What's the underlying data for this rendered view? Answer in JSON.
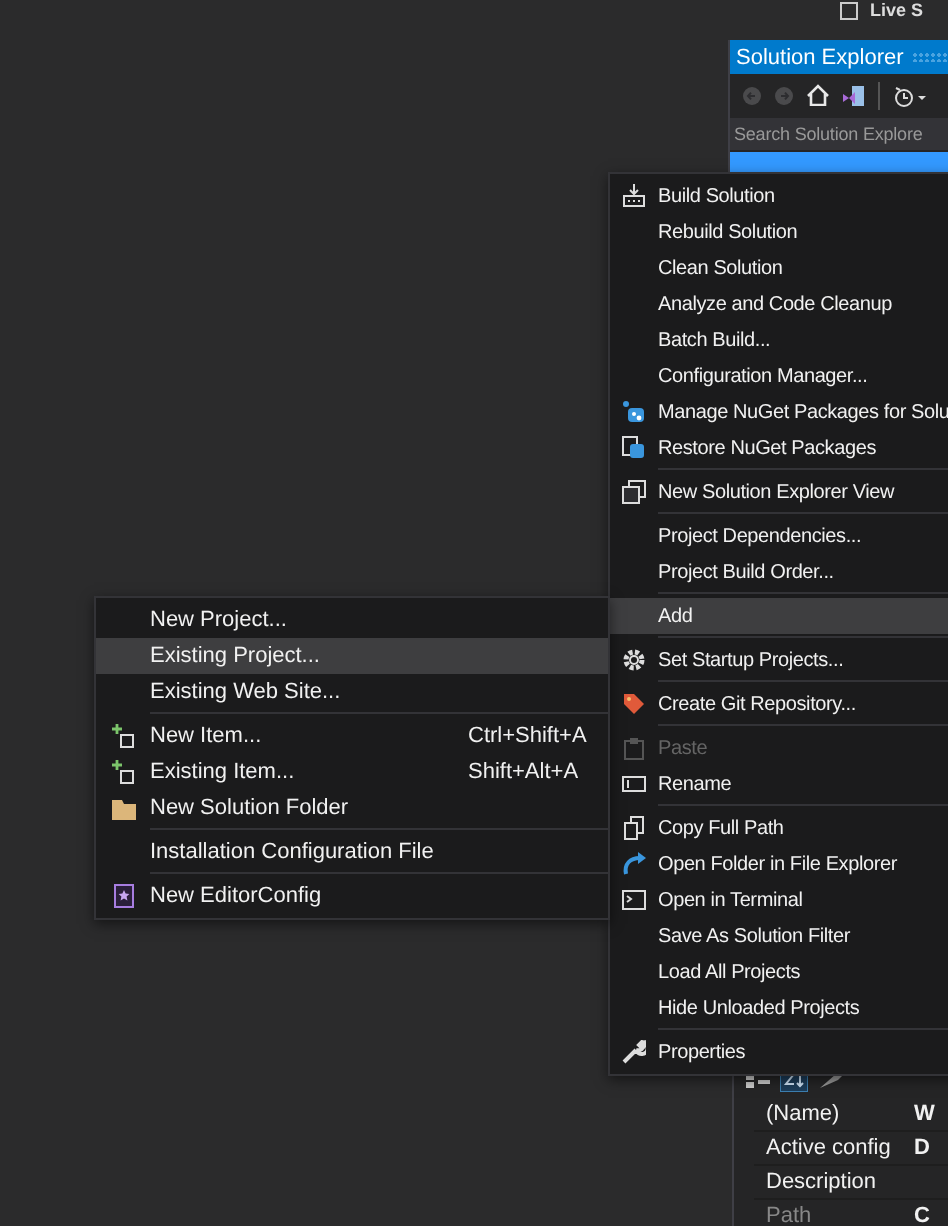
{
  "top_bar": {
    "label": "Live S"
  },
  "solution_explorer": {
    "title": "Solution Explorer",
    "search": {
      "placeholder": "Search Solution Explore"
    }
  },
  "context_menu": {
    "items": [
      {
        "kind": "item",
        "label": "Build Solution",
        "selected": false,
        "disabled": false
      },
      {
        "kind": "item",
        "label": "Rebuild Solution",
        "selected": false,
        "disabled": false
      },
      {
        "kind": "item",
        "label": "Clean Solution",
        "selected": false,
        "disabled": false
      },
      {
        "kind": "item",
        "label": "Analyze and Code Cleanup",
        "selected": false,
        "disabled": false
      },
      {
        "kind": "item",
        "label": "Batch Build...",
        "selected": false,
        "disabled": false
      },
      {
        "kind": "item",
        "label": "Configuration Manager...",
        "selected": false,
        "disabled": false
      },
      {
        "kind": "item",
        "label": "Manage NuGet Packages for Solu",
        "selected": false,
        "disabled": false
      },
      {
        "kind": "item",
        "label": "Restore NuGet Packages",
        "selected": false,
        "disabled": false
      },
      {
        "kind": "separator"
      },
      {
        "kind": "item",
        "label": "New Solution Explorer View",
        "selected": false,
        "disabled": false
      },
      {
        "kind": "separator"
      },
      {
        "kind": "item",
        "label": "Project Dependencies...",
        "selected": false,
        "disabled": false
      },
      {
        "kind": "item",
        "label": "Project Build Order...",
        "selected": false,
        "disabled": false
      },
      {
        "kind": "separator"
      },
      {
        "kind": "item",
        "label": "Add",
        "selected": true,
        "disabled": false
      },
      {
        "kind": "separator"
      },
      {
        "kind": "item",
        "label": "Set Startup Projects...",
        "selected": false,
        "disabled": false
      },
      {
        "kind": "separator"
      },
      {
        "kind": "item",
        "label": "Create Git Repository...",
        "selected": false,
        "disabled": false
      },
      {
        "kind": "separator"
      },
      {
        "kind": "item",
        "label": "Paste",
        "selected": false,
        "disabled": true
      },
      {
        "kind": "item",
        "label": "Rename",
        "selected": false,
        "disabled": false
      },
      {
        "kind": "separator"
      },
      {
        "kind": "item",
        "label": "Copy Full Path",
        "selected": false,
        "disabled": false
      },
      {
        "kind": "item",
        "label": "Open Folder in File Explorer",
        "selected": false,
        "disabled": false
      },
      {
        "kind": "item",
        "label": "Open in Terminal",
        "selected": false,
        "disabled": false
      },
      {
        "kind": "item",
        "label": "Save As Solution Filter",
        "selected": false,
        "disabled": false
      },
      {
        "kind": "item",
        "label": "Load All Projects",
        "selected": false,
        "disabled": false
      },
      {
        "kind": "item",
        "label": "Hide Unloaded Projects",
        "selected": false,
        "disabled": false
      },
      {
        "kind": "separator"
      },
      {
        "kind": "item",
        "label": "Properties",
        "selected": false,
        "disabled": false
      }
    ]
  },
  "add_submenu": {
    "items": [
      {
        "kind": "item",
        "label": "New Project...",
        "selected": false
      },
      {
        "kind": "item",
        "label": "Existing Project...",
        "selected": true
      },
      {
        "kind": "item",
        "label": "Existing Web Site...",
        "selected": false
      },
      {
        "kind": "separator"
      },
      {
        "kind": "item",
        "label": "New Item...",
        "shortcut": "Ctrl+Shift+A",
        "selected": false
      },
      {
        "kind": "item",
        "label": "Existing Item...",
        "shortcut": "Shift+Alt+A",
        "selected": false
      },
      {
        "kind": "item",
        "label": "New Solution Folder",
        "selected": false
      },
      {
        "kind": "separator"
      },
      {
        "kind": "item",
        "label": "Installation Configuration File",
        "selected": false
      },
      {
        "kind": "separator"
      },
      {
        "kind": "item",
        "label": "New EditorConfig",
        "selected": false
      }
    ]
  },
  "properties": {
    "rows": [
      {
        "name": "(Name)",
        "value": "W",
        "disabled": false
      },
      {
        "name": "Active config",
        "value": "D",
        "disabled": false
      },
      {
        "name": "Description",
        "value": "",
        "disabled": false
      },
      {
        "name": "Path",
        "value": "C",
        "disabled": true
      }
    ]
  }
}
